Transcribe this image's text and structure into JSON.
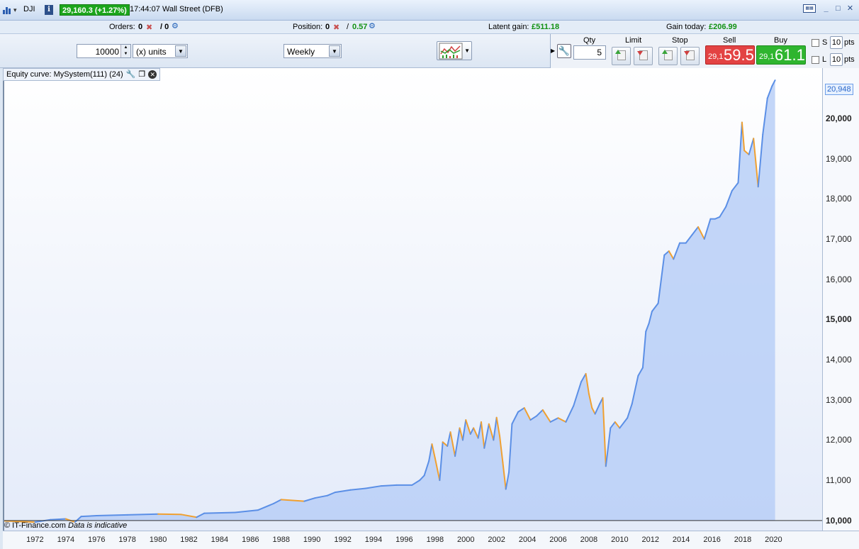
{
  "titlebar": {
    "symbol": "DJI",
    "price_badge": "29,160.3 (+1.27%)",
    "time": "17:44:07",
    "instrument": "Wall Street (DFB)",
    "info_label": "i",
    "window_buttons": [
      "_",
      "□",
      "✕"
    ]
  },
  "status": {
    "orders_label": "Orders:",
    "orders_value_1": "0",
    "orders_value_2": "/ 0",
    "position_label": "Position:",
    "position_value": "0",
    "position_sep": "/",
    "position_pnl": "0.57",
    "latent_label": "Latent gain:",
    "latent_value": "£511.18",
    "gain_today_label": "Gain today:",
    "gain_today_value": "£206.99"
  },
  "controls": {
    "size_value": "10000",
    "units_option": "(x) units",
    "period_option": "Weekly"
  },
  "order_panel": {
    "qty_label": "Qty",
    "qty_value": "5",
    "limit_label": "Limit",
    "stop_label": "Stop",
    "sell_label": "Sell",
    "buy_label": "Buy",
    "sell_small": "29,1",
    "sell_big": "59.5",
    "buy_small": "29,1",
    "buy_big": "61.1",
    "s_label": "S",
    "l_label": "L",
    "s_pts": "10",
    "l_pts": "10",
    "pts_label": "pts",
    "colors": {
      "sell": "#e34343",
      "buy": "#2fb52f"
    }
  },
  "panel": {
    "title": "Equity curve: MySystem(111) (24)",
    "footer_copyright": "© IT-Finance.com",
    "footer_note": "Data is indicative",
    "last_value_badge": "20,948"
  },
  "chart_data": {
    "type": "area",
    "ylim": [
      9750,
      21250
    ],
    "xlim": [
      1970.0,
      2021.5
    ],
    "baseline": 10000,
    "y_ticks": [
      "10,000",
      "11,000",
      "12,000",
      "13,000",
      "14,000",
      "15,000",
      "16,000",
      "17,000",
      "18,000",
      "19,000",
      "20,000"
    ],
    "y_tick_values": [
      10000,
      11000,
      12000,
      13000,
      14000,
      15000,
      16000,
      17000,
      18000,
      19000,
      20000
    ],
    "x_ticks": [
      "1972",
      "1974",
      "1976",
      "1978",
      "1980",
      "1982",
      "1984",
      "1986",
      "1988",
      "1990",
      "1992",
      "1994",
      "1996",
      "1998",
      "2000",
      "2002",
      "2004",
      "2006",
      "2008",
      "2010",
      "2012",
      "2014",
      "2016",
      "2018",
      "2020"
    ],
    "x_tick_values": [
      1972,
      1974,
      1976,
      1978,
      1980,
      1982,
      1984,
      1986,
      1988,
      1990,
      1992,
      1994,
      1996,
      1998,
      2000,
      2002,
      2004,
      2006,
      2008,
      2010,
      2012,
      2014,
      2016,
      2018,
      2020
    ],
    "line_color": "#5b8fe6",
    "drawdown_color": "#f0a030",
    "fill_color": "#b8cff7",
    "series": [
      {
        "x": [
          1970.0,
          1972.0,
          1973.0,
          1974.0,
          1974.6,
          1975.0,
          1976.0,
          1978.0,
          1980.0,
          1981.5,
          1982.5,
          1983.0,
          1985.0,
          1986.5,
          1987.5,
          1988.0,
          1989.5,
          1990.2,
          1991.0,
          1991.5,
          1992.5,
          1993.5,
          1994.5,
          1995.5,
          1996.5,
          1997.0,
          1997.3,
          1997.6,
          1997.8,
          1998.0,
          1998.3,
          1998.5,
          1998.8,
          1999.0,
          1999.3,
          1999.6,
          1999.8,
          2000.0,
          2000.3,
          2000.5,
          2000.8,
          2001.0,
          2001.2,
          2001.5,
          2001.8,
          2002.0,
          2002.2,
          2002.4,
          2002.6,
          2002.8,
          2003.0,
          2003.4,
          2003.8,
          2004.2,
          2004.6,
          2005.0,
          2005.5,
          2006.0,
          2006.5,
          2007.0,
          2007.5,
          2007.8,
          2008.0,
          2008.2,
          2008.4,
          2008.7,
          2008.9,
          2009.1,
          2009.4,
          2009.7,
          2010.0,
          2010.5,
          2010.8,
          2011.2,
          2011.5,
          2011.7,
          2011.9,
          2012.1,
          2012.5,
          2012.9,
          2013.2,
          2013.5,
          2013.9,
          2014.3,
          2014.7,
          2015.1,
          2015.5,
          2015.9,
          2016.2,
          2016.5,
          2016.9,
          2017.3,
          2017.7,
          2017.95,
          2018.1,
          2018.4,
          2018.7,
          2019.0,
          2019.3,
          2019.6,
          2019.9,
          2020.1
        ],
        "y": [
          9990,
          9960,
          10020,
          10040,
          9960,
          10100,
          10120,
          10140,
          10160,
          10150,
          10080,
          10180,
          10200,
          10260,
          10420,
          10520,
          10480,
          10560,
          10620,
          10700,
          10760,
          10800,
          10860,
          10880,
          10880,
          11000,
          11120,
          11480,
          11900,
          11550,
          11000,
          11950,
          11850,
          12200,
          11600,
          12300,
          12000,
          12500,
          12150,
          12300,
          12050,
          12450,
          11800,
          12400,
          12000,
          12560,
          12100,
          11450,
          10780,
          11200,
          12400,
          12700,
          12800,
          12500,
          12600,
          12750,
          12450,
          12550,
          12450,
          12850,
          13450,
          13650,
          13150,
          12800,
          12650,
          12900,
          13050,
          11350,
          12300,
          12450,
          12300,
          12550,
          12900,
          13600,
          13800,
          14700,
          14900,
          15200,
          15400,
          16600,
          16700,
          16500,
          16900,
          16900,
          17100,
          17300,
          17000,
          17500,
          17500,
          17550,
          17800,
          18200,
          18400,
          19900,
          19200,
          19100,
          19500,
          18300,
          19600,
          20500,
          20800,
          20948
        ]
      }
    ]
  }
}
